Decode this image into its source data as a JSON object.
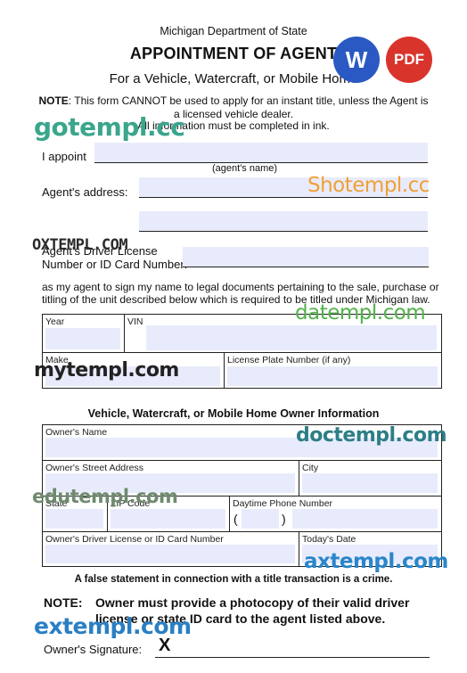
{
  "header": {
    "department": "Michigan Department of State",
    "title": "APPOINTMENT OF AGENT",
    "subtitle": "For a Vehicle, Watercraft, or Mobile Home",
    "note_label": "NOTE",
    "note_text": ": This form CANNOT be used to apply for an instant title, unless the Agent is",
    "note_text2": "a licensed vehicle dealer.",
    "ink_note": "All information must be completed in ink."
  },
  "badges": {
    "word": "W",
    "pdf": "PDF",
    "word_color": "#2b59c3",
    "pdf_color": "#d9342b"
  },
  "fields": {
    "appoint_label": "I appoint",
    "agent_name_caption": "(agent's name)",
    "agent_address_label": "Agent's address:",
    "license_label_1": "Agent's Driver License",
    "license_label_2": "Number or ID Card Number:",
    "authorization_text_1": "as my agent to sign my name to legal documents pertaining to the sale, purchase or",
    "authorization_text_2": "titling of the unit described below which is required to be titled under Michigan law."
  },
  "vehicle_table": {
    "year": "Year",
    "vin": "VIN",
    "make": "Make",
    "plate": "License Plate Number (if any)"
  },
  "owner_section": {
    "title": "Vehicle, Watercraft, or Mobile Home Owner Information",
    "name": "Owner's Name",
    "street": "Owner's Street Address",
    "city": "City",
    "state": "State",
    "zip": "ZIP Code",
    "phone": "Daytime Phone Number",
    "phone_open": "(",
    "phone_close": ")",
    "license": "Owner's Driver License or ID Card Number",
    "date": "Today's Date"
  },
  "footer": {
    "false_statement": "A false statement in connection with a title transaction is a crime.",
    "note_label": "NOTE:",
    "note_line1": "Owner must provide a photocopy of their valid driver",
    "note_line2": "license or state ID card to the agent listed above.",
    "signature_label": "Owner's Signature:",
    "signature_mark": "X"
  },
  "watermarks": {
    "gotempl": "gotempl.cc",
    "shotempl": "Shotempl.cc",
    "oxtempl": "OXTEMPL.COM",
    "datempl": "datempl.com",
    "mytempl": "mytempl.com",
    "doctempl": "doctempl.com",
    "edutempl": "edutempl.com",
    "axtempl": "axtempl.com",
    "extempl": "extempl.com"
  }
}
